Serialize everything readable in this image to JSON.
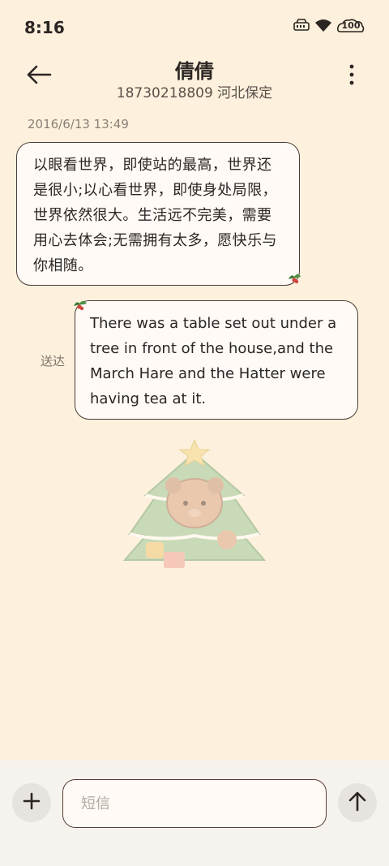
{
  "status_bar": {
    "time": "8:16",
    "battery_level": "100",
    "icons": [
      "nfc-icon",
      "wifi-icon",
      "battery-icon"
    ]
  },
  "header": {
    "contact_name": "倩倩",
    "contact_number": "18730218809 河北保定",
    "icons": [
      "back-arrow-icon",
      "more-vertical-icon"
    ]
  },
  "conversation": {
    "timestamp": "2016/6/13 13:49",
    "messages": [
      {
        "direction": "incoming",
        "text": "以眼看世界，即使站的最高，世界还是很小;以心看世界，即使身处局限，世界依然很大。生活远不完美，需要用心去体会;无需拥有太多，愿快乐与你相随。"
      },
      {
        "direction": "outgoing",
        "text": "There was a table set out under a tree in front of the house,and the March Hare and the Hatter were having tea at it.",
        "status": "送达"
      }
    ]
  },
  "composer": {
    "placeholder": "短信",
    "value": "",
    "icons": [
      "plus-icon",
      "send-arrow-up-icon"
    ]
  },
  "colors": {
    "background": "#fdf0dc",
    "bubble_fill": "#fffaf6",
    "bubble_border": "#4a3c35",
    "holly_green": "#3f7a3a",
    "holly_red": "#d2463c",
    "composer_bg": "#f6f3ef"
  }
}
